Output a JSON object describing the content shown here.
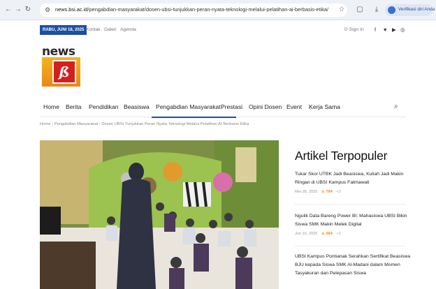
{
  "browser": {
    "url_host": "news.bsi.ac.id",
    "url_path": "/pengabdian-masyarakat/dosen-ubsi-tunjukkan-peran-nyata-teknologi-melalui-pelatihan-ai-berbasis-etika/",
    "profile_label": "Verifikasi diri Anda"
  },
  "topbar": {
    "date": "RABU, JUNI 18, 2025",
    "links": [
      "Kontak",
      "Galeri",
      "Agenda"
    ],
    "signin": "Sign In"
  },
  "logo": {
    "word": "news",
    "mark": "BSI"
  },
  "nav": {
    "items": [
      "Home",
      "Berita",
      "Pendidikan",
      "Beasiswa",
      "Pengabdian Masyarakat",
      "Prestasi",
      "Opini Dosen",
      "Event",
      "Kerja Sama"
    ],
    "active": "Pengabdian Masyarakat"
  },
  "breadcrumb": {
    "home": "Home",
    "category": "Pengabdian Masyarakat",
    "current": "Dosen UBSI Tunjukkan Peran Nyata Teknologi Melalui Pelatihan AI Berbasis Etika"
  },
  "sidebar": {
    "title": "Artikel Terpopuler",
    "articles": [
      {
        "title": "Tukar Skor UTBK Jadi Beasiswa, Kuliah Jadi Makin Ringan di UBSI Kampus Fatmawati",
        "date": "Mei 28, 2025",
        "views": "764",
        "comments": "0"
      },
      {
        "title": "Ngulik Data Bareng Power BI: Mahasiswa UBSI Bikin Siswa SMK Makin Melek Digital",
        "date": "Jun 10, 2025",
        "views": "564",
        "comments": "0"
      },
      {
        "title": "UBSI Kampus Pontianak Serahkan Sertifikat Beasiswa BJU kepada Siswa SMK Al-Madani dalam Momen Tasyakuran dan Pelepasan Siswa",
        "date": "",
        "views": "",
        "comments": ""
      }
    ]
  },
  "colors": {
    "brand": "#1d4fa3",
    "accent": "#e8891a",
    "logo_red": "#d61e1e"
  },
  "icons": [
    "back-icon",
    "forward-icon",
    "reload-icon",
    "site-info-icon",
    "star-icon",
    "extensions-icon",
    "download-icon",
    "user-icon",
    "facebook-icon",
    "twitter-icon",
    "youtube-icon",
    "instagram-icon",
    "search-icon",
    "fire-icon",
    "share-icon"
  ]
}
